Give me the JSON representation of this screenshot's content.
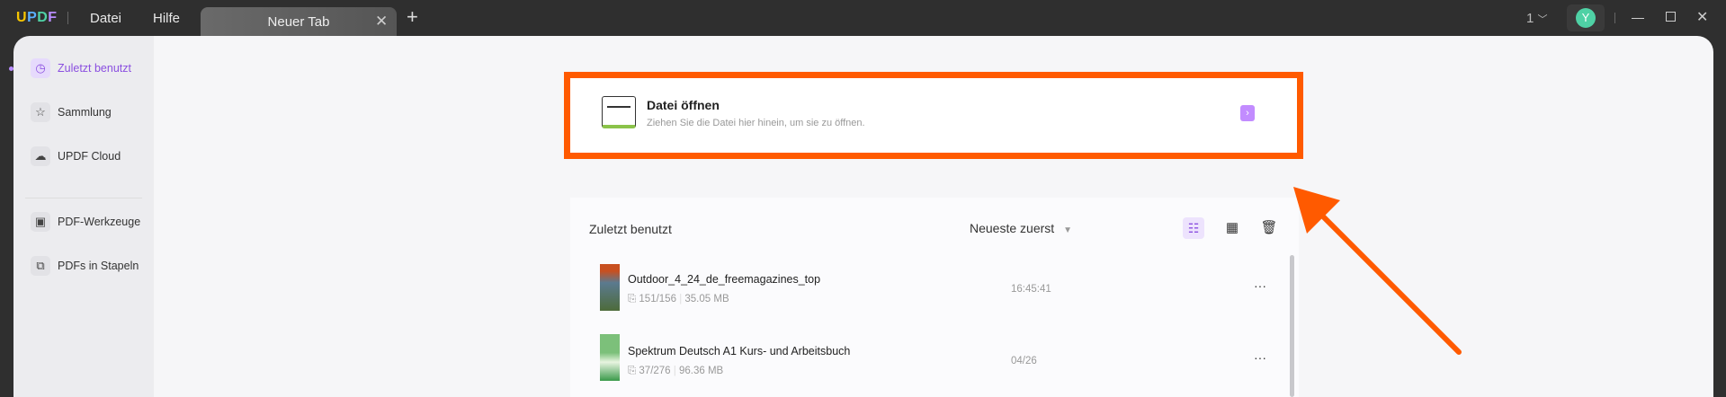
{
  "titlebar": {
    "logo": "UPDF",
    "menu": [
      "Datei",
      "Hilfe"
    ],
    "tab": "Neuer Tab",
    "page_count": "1",
    "avatar": "Y"
  },
  "sidebar": {
    "items": [
      {
        "label": "Zuletzt benutzt"
      },
      {
        "label": "Sammlung"
      },
      {
        "label": "UPDF Cloud"
      },
      {
        "label": "PDF-Werkzeuge"
      },
      {
        "label": "PDFs in Stapeln"
      }
    ]
  },
  "open_file": {
    "title": "Datei öffnen",
    "subtitle": "Ziehen Sie die Datei hier hinein, um sie zu öffnen."
  },
  "recent": {
    "title": "Zuletzt benutzt",
    "sort": "Neueste zuerst",
    "files": [
      {
        "name": "Outdoor_4_24_de_freemagazines_top",
        "pages": "151/156",
        "size": "35.05 MB",
        "time": "16:45:41"
      },
      {
        "name": "Spektrum Deutsch A1 Kurs- und Arbeitsbuch",
        "pages": "37/276",
        "size": "96.36 MB",
        "time": "04/26"
      }
    ]
  },
  "colors": {
    "accent": "#8b4fe0",
    "highlight": "#ff5a00",
    "avatar": "#4fd1a5"
  }
}
